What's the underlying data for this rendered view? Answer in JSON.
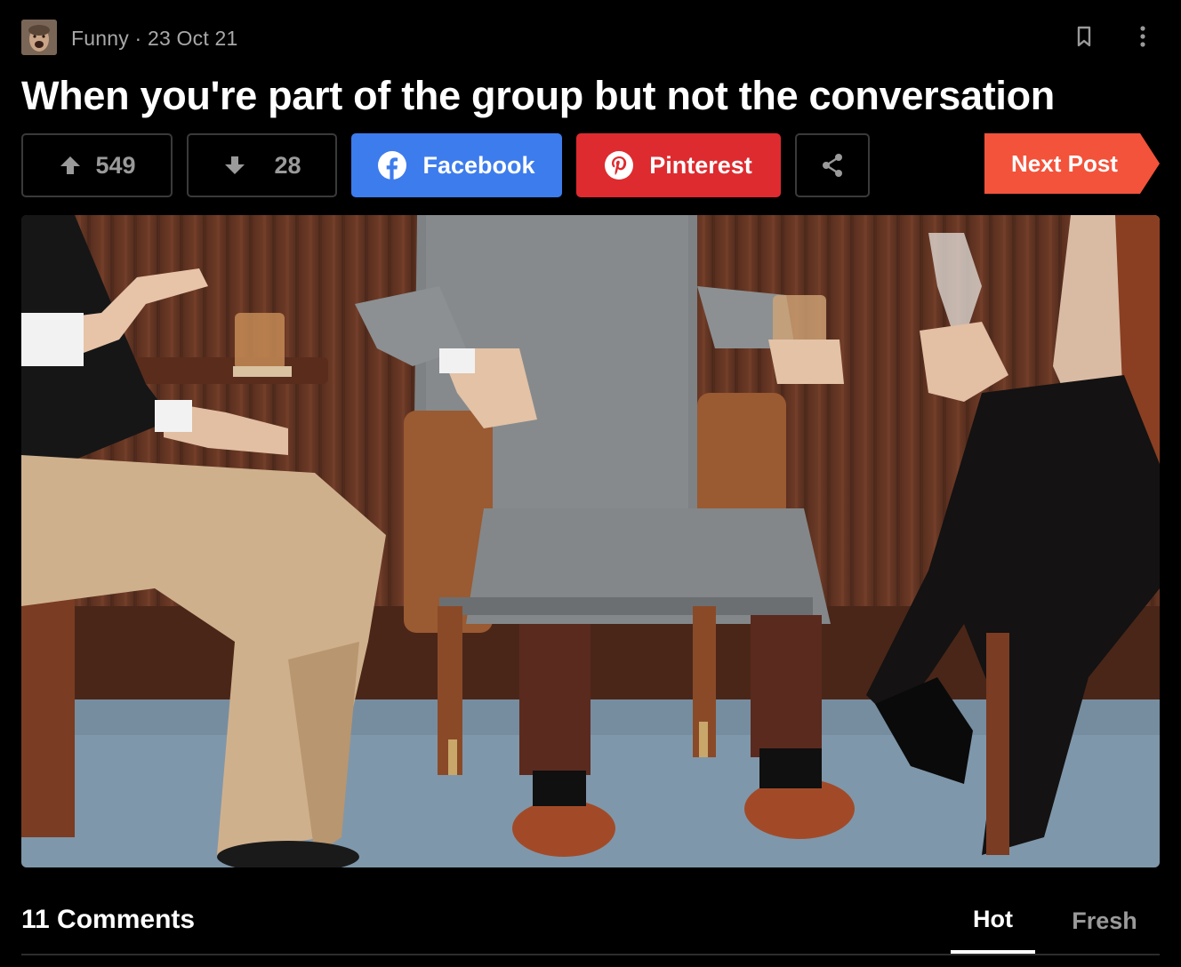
{
  "post": {
    "section": "Funny",
    "separator": "·",
    "date": "23 Oct 21",
    "title": "When you're part of the group but not the conversation"
  },
  "actions": {
    "upvotes": "549",
    "downvotes": "28",
    "facebook_label": "Facebook",
    "pinterest_label": "Pinterest",
    "next_label": "Next Post"
  },
  "icons": {
    "avatar": "avatar-image",
    "bookmark": "bookmark-icon",
    "more": "more-vertical-icon",
    "upvote": "arrow-up-icon",
    "downvote": "arrow-down-icon",
    "facebook": "facebook-icon",
    "pinterest": "pinterest-icon",
    "share": "share-icon"
  },
  "colors": {
    "background": "#000000",
    "facebook": "#3d7ced",
    "pinterest": "#de2b2f",
    "next_post": "#f2533a",
    "muted_text": "#9a9a9a"
  },
  "comments": {
    "count_label": "11 Comments",
    "tabs": [
      {
        "label": "Hot",
        "active": true
      },
      {
        "label": "Fresh",
        "active": false
      }
    ]
  }
}
